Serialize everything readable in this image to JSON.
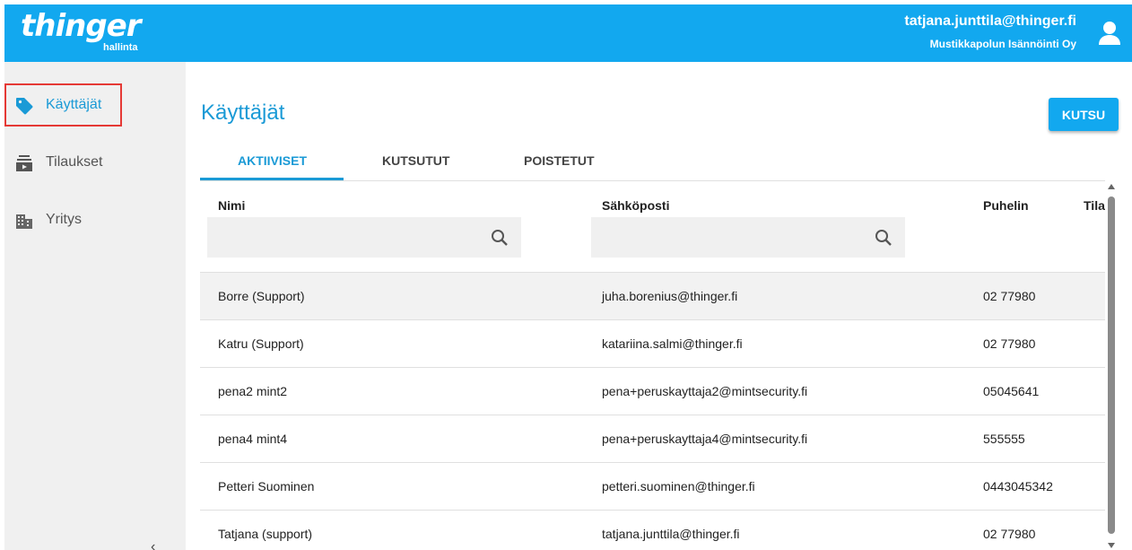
{
  "header": {
    "logo_text": "thinger",
    "logo_subtitle": "hallinta",
    "user_email": "tatjana.junttila@thinger.fi",
    "user_org": "Mustikkapolun Isännöinti Oy",
    "accent_color": "#12a8ef"
  },
  "sidebar": {
    "items": [
      {
        "label": "Käyttäjät",
        "icon": "tag-icon",
        "active": true
      },
      {
        "label": "Tilaukset",
        "icon": "subscriptions-icon",
        "active": false
      },
      {
        "label": "Yritys",
        "icon": "building-icon",
        "active": false
      }
    ],
    "collapse_glyph": "‹"
  },
  "main": {
    "title": "Käyttäjät",
    "invite_button": "KUTSU",
    "tabs": [
      {
        "label": "AKTIIVISET",
        "active": true
      },
      {
        "label": "KUTSUTUT",
        "active": false
      },
      {
        "label": "POISTETUT",
        "active": false
      }
    ],
    "table": {
      "columns": [
        "Nimi",
        "Sähköposti",
        "Puhelin",
        "Tila"
      ],
      "name_filter_value": "",
      "email_filter_value": "",
      "rows": [
        {
          "name": "Borre (Support)",
          "email": "juha.borenius@thinger.fi",
          "phone": "02 77980"
        },
        {
          "name": "Katru (Support)",
          "email": "katariina.salmi@thinger.fi",
          "phone": "02 77980"
        },
        {
          "name": "pena2 mint2",
          "email": "pena+peruskayttaja2@mintsecurity.fi",
          "phone": "05045641"
        },
        {
          "name": "pena4 mint4",
          "email": "pena+peruskayttaja4@mintsecurity.fi",
          "phone": "555555"
        },
        {
          "name": "Petteri Suominen",
          "email": "petteri.suominen@thinger.fi",
          "phone": "0443045342"
        },
        {
          "name": "Tatjana (support)",
          "email": "tatjana.junttila@thinger.fi",
          "phone": "02 77980"
        }
      ]
    }
  }
}
